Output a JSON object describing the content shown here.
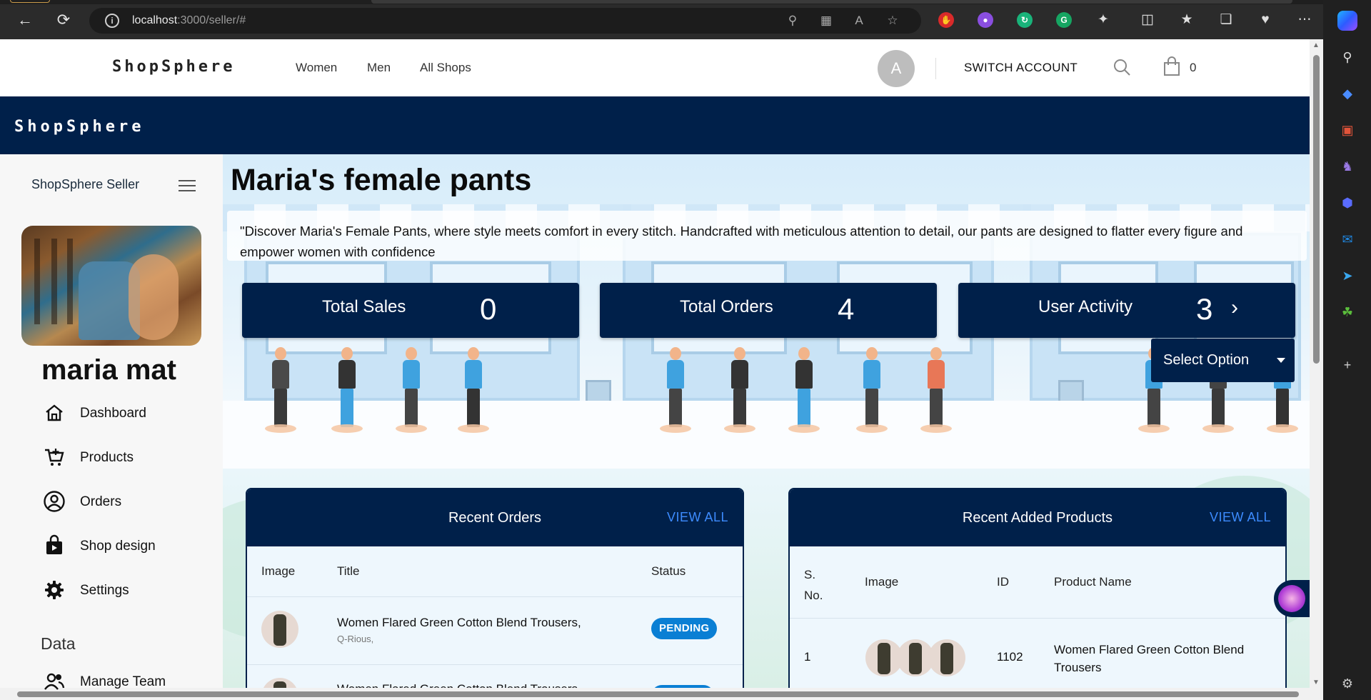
{
  "browser": {
    "url_host": "localhost",
    "url_rest": ":3000/seller/#"
  },
  "header": {
    "logo": "ShopSphere",
    "nav": [
      "Women",
      "Men",
      "All Shops"
    ],
    "avatar_letter": "A",
    "switch_account": "SWITCH ACCOUNT",
    "cart_count": "0"
  },
  "brand_bar": {
    "title": "ShopSphere"
  },
  "sidebar": {
    "title": "ShopSphere Seller",
    "owner_name": "maria mat",
    "menu": [
      {
        "label": "Dashboard",
        "icon": "home-icon"
      },
      {
        "label": "Products",
        "icon": "cart-plus-icon"
      },
      {
        "label": "Orders",
        "icon": "user-circle-icon"
      },
      {
        "label": "Shop design",
        "icon": "shopping-bag-icon"
      },
      {
        "label": "Settings",
        "icon": "gear-icon"
      }
    ],
    "section_label": "Data",
    "data_menu": [
      {
        "label": "Manage Team",
        "icon": "team-icon"
      }
    ]
  },
  "shop": {
    "title": "Maria's female pants",
    "description": "\"Discover Maria's Female Pants, where style meets comfort in every stitch. Handcrafted with meticulous attention to detail, our pants are designed to flatter every figure and empower women with confidence"
  },
  "stats": [
    {
      "label": "Total Sales",
      "value": "0"
    },
    {
      "label": "Total Orders",
      "value": "4"
    },
    {
      "label": "User Activity",
      "value": "3"
    }
  ],
  "select": {
    "label": "Select Option"
  },
  "recent_orders": {
    "title": "Recent Orders",
    "view_all": "VIEW ALL",
    "columns": [
      "Image",
      "Title",
      "Status"
    ],
    "rows": [
      {
        "title": "Women Flared Green Cotton Blend Trousers,",
        "brand": "Q-Rious,",
        "status": "PENDING"
      },
      {
        "title": "Women Flared Green Cotton Blend Trousers,",
        "brand": "",
        "status": ""
      }
    ]
  },
  "recent_products": {
    "title": "Recent Added Products",
    "view_all": "VIEW ALL",
    "columns": [
      "S. No.",
      "Image",
      "ID",
      "Product Name"
    ],
    "rows": [
      {
        "sno": "1",
        "id": "1102",
        "name": "Women Flared Green Cotton Blend Trousers"
      }
    ]
  },
  "colors": {
    "navy": "#00204a",
    "badge_blue": "#0a7fd4",
    "link_blue": "#3d8cff"
  }
}
